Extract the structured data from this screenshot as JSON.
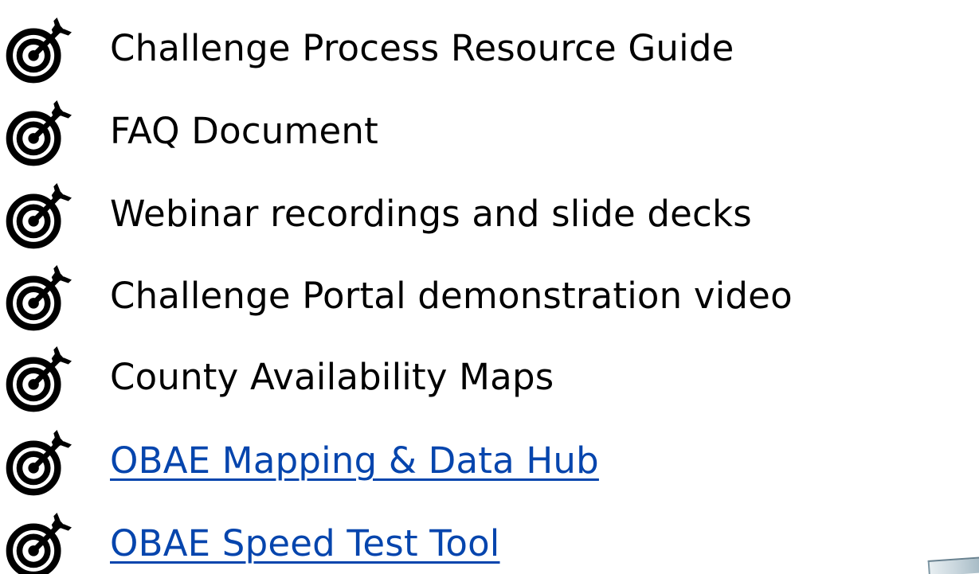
{
  "resources": [
    {
      "icon": "target-arrow-icon",
      "label": "Challenge Process Resource Guide",
      "link": false
    },
    {
      "icon": "target-arrow-icon",
      "label": "FAQ Document",
      "link": false
    },
    {
      "icon": "target-arrow-icon",
      "label": "Webinar recordings and slide decks",
      "link": false
    },
    {
      "icon": "target-arrow-icon",
      "label": "Challenge Portal demonstration video",
      "link": false
    },
    {
      "icon": "target-arrow-icon",
      "label": "County Availability Maps",
      "link": false
    },
    {
      "icon": "target-arrow-icon",
      "label": "OBAE Mapping & Data Hub",
      "link": true
    },
    {
      "icon": "target-arrow-icon",
      "label": "OBAE Speed Test Tool",
      "link": true
    }
  ],
  "colors": {
    "text": "#000000",
    "link": "#0645ad",
    "background": "#ffffff"
  }
}
